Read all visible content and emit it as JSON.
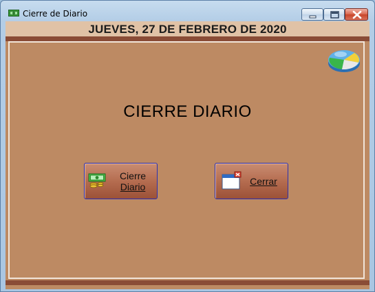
{
  "window": {
    "title": "Cierre de Diario",
    "controls": {
      "minimize": "minimize-icon",
      "maximize": "maximize-icon",
      "close": "close-icon"
    }
  },
  "header": {
    "date": "JUEVES, 27 DE FEBRERO DE 2020"
  },
  "main": {
    "heading": "CIERRE DIARIO",
    "buttons": [
      {
        "label_line1": "Cierre",
        "label_line2": "Diario",
        "icon": "money-icon"
      },
      {
        "label": "Cerrar",
        "icon": "close-window-icon"
      }
    ],
    "corner_icon": "pie-chart-icon"
  },
  "colors": {
    "background": "#bd8a63",
    "date_bar": "#e0c2a6",
    "strip": "#8a4c36",
    "button_border": "#2a2fb0"
  }
}
